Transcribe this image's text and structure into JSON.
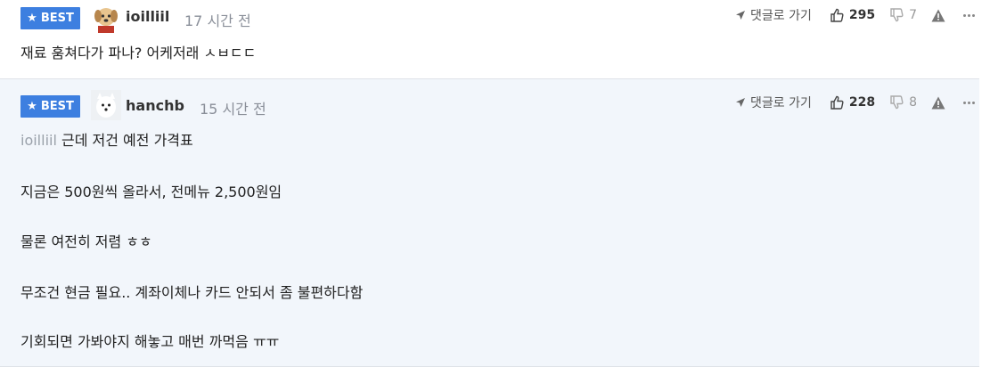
{
  "comments": [
    {
      "badge": "BEST",
      "username": "ioilliil",
      "time": "17 시간 전",
      "reply_label": "댓글로 가기",
      "likes": "295",
      "dislikes": "7",
      "lines": [
        "재료 훔쳐다가 파나? 어케저래 ㅅㅂㄷㄷ"
      ]
    },
    {
      "badge": "BEST",
      "username": "hanchb",
      "time": "15 시간 전",
      "reply_label": "댓글로 가기",
      "likes": "228",
      "dislikes": "8",
      "mention": "ioilliil",
      "lines": [
        "근데 저건 예전 가격표",
        "지금은 500원씩 올라서, 전메뉴 2,500원임",
        "물론 여전히 저렴 ㅎㅎ",
        "무조건 현금 필요.. 계좌이체나 카드 안되서 좀 불편하다함",
        "기회되면 가봐야지 해놓고 매번 까먹음 ㅠㅠ"
      ]
    }
  ],
  "colors": {
    "badge": "#3d7fe0",
    "best_bg": "#f2f6fb",
    "mention": "#9aa1aa"
  },
  "icons": [
    "star-icon",
    "send-icon",
    "thumbs-up-icon",
    "thumbs-down-icon",
    "warning-icon",
    "more-icon"
  ]
}
